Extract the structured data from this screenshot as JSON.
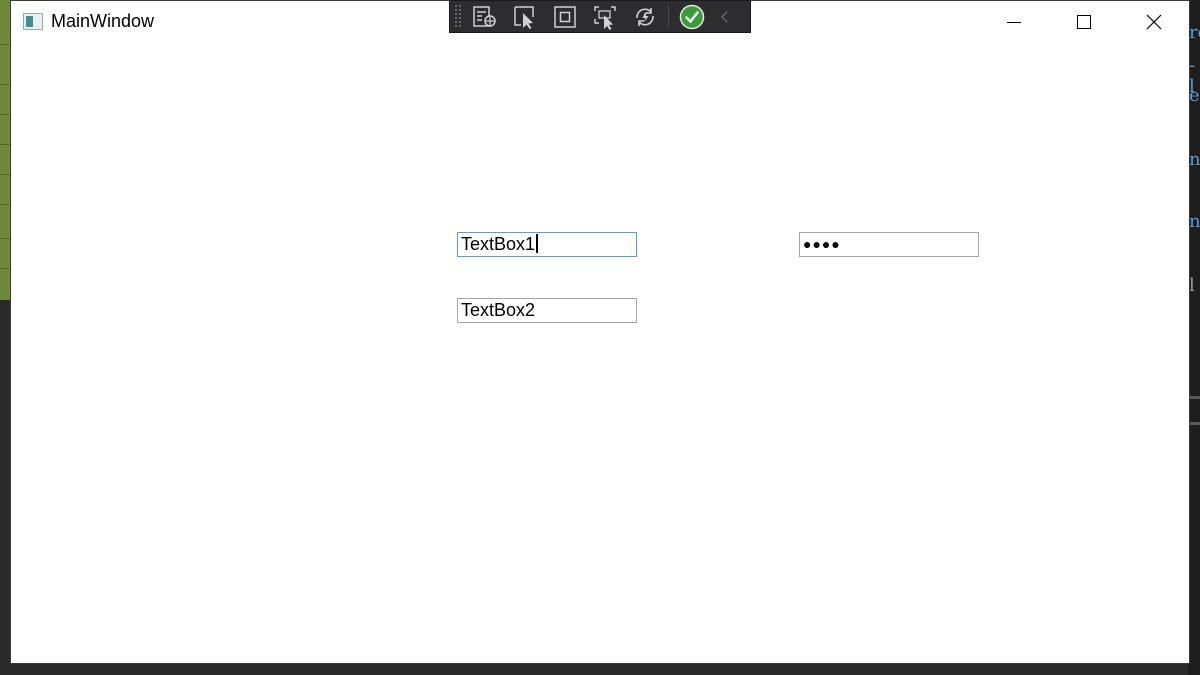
{
  "window": {
    "title": "MainWindow",
    "controls": {
      "minimize": "minimize",
      "maximize": "maximize",
      "close": "close"
    }
  },
  "debug_toolbar": {
    "buttons": [
      {
        "icon": "live-visual-tree-icon"
      },
      {
        "icon": "select-element-icon"
      },
      {
        "icon": "display-layout-adorners-icon"
      },
      {
        "icon": "track-focused-element-icon"
      },
      {
        "icon": "hot-reload-icon"
      },
      {
        "icon": "binding-failures-ok-icon"
      },
      {
        "icon": "collapse-toolbar-icon"
      }
    ],
    "colors": {
      "background": "#2d2d30",
      "icon": "#d0d0d0",
      "ok_green": "#3a9b3a"
    }
  },
  "form": {
    "textbox1": {
      "value": "TextBox1",
      "focused": true
    },
    "textbox2": {
      "value": "TextBox2"
    },
    "password": {
      "masked_value": "●●●●"
    }
  },
  "background_code_fragments": [
    "ro",
    "-l",
    "e=",
    "ne",
    "ne",
    "l"
  ]
}
